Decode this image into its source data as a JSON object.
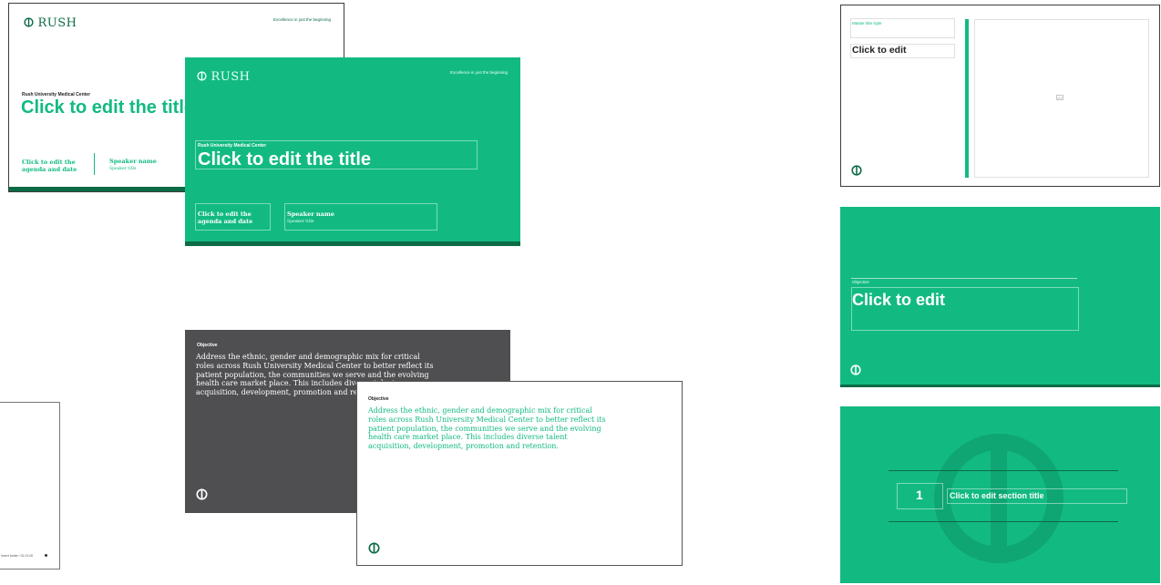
{
  "slideA": {
    "brand": "RUSH",
    "tagline": "Excellence in just the beginning",
    "org": "Rush University Medical Center",
    "title": "Click to edit the title",
    "agenda": "Click to edit the agenda and date",
    "speaker_name": "Speaker name",
    "speaker_title": "Speaker title"
  },
  "slideB": {
    "brand": "RUSH",
    "tagline": "Excellence in just the beginning",
    "org": "Rush University Medical Center",
    "title": "Click to edit the title",
    "agenda": "Click to edit the agenda and date",
    "speaker_name": "Speaker name",
    "speaker_title": "Speaker title"
  },
  "slideC": {
    "label": "Objective",
    "body": "Address the ethnic, gender and demographic mix for critical roles across Rush University Medical Center to better reflect its patient population, the communities we serve and the evolving health care market place. This includes diverse talent acquisition, development, promotion and retention."
  },
  "slideD": {
    "label": "Objective",
    "body": "Address the ethnic, gender and demographic mix for critical roles across Rush University Medical Center to better reflect its patient population, the communities we serve and the evolving health care market place. This includes diverse talent acquisition, development, promotion and retention."
  },
  "slideE": {
    "footer_text": "Insert footer / 01.01.00"
  },
  "slideF": {
    "small_label": "Master title style",
    "title": "Click to edit"
  },
  "slideG": {
    "label": "Objective",
    "title": "Click to edit"
  },
  "slideH": {
    "number": "1",
    "title": "Click to edit section title"
  },
  "colors": {
    "brand_green": "#12ba82",
    "dark_green": "#0c6b45",
    "dark_gray": "#4f4f51"
  }
}
